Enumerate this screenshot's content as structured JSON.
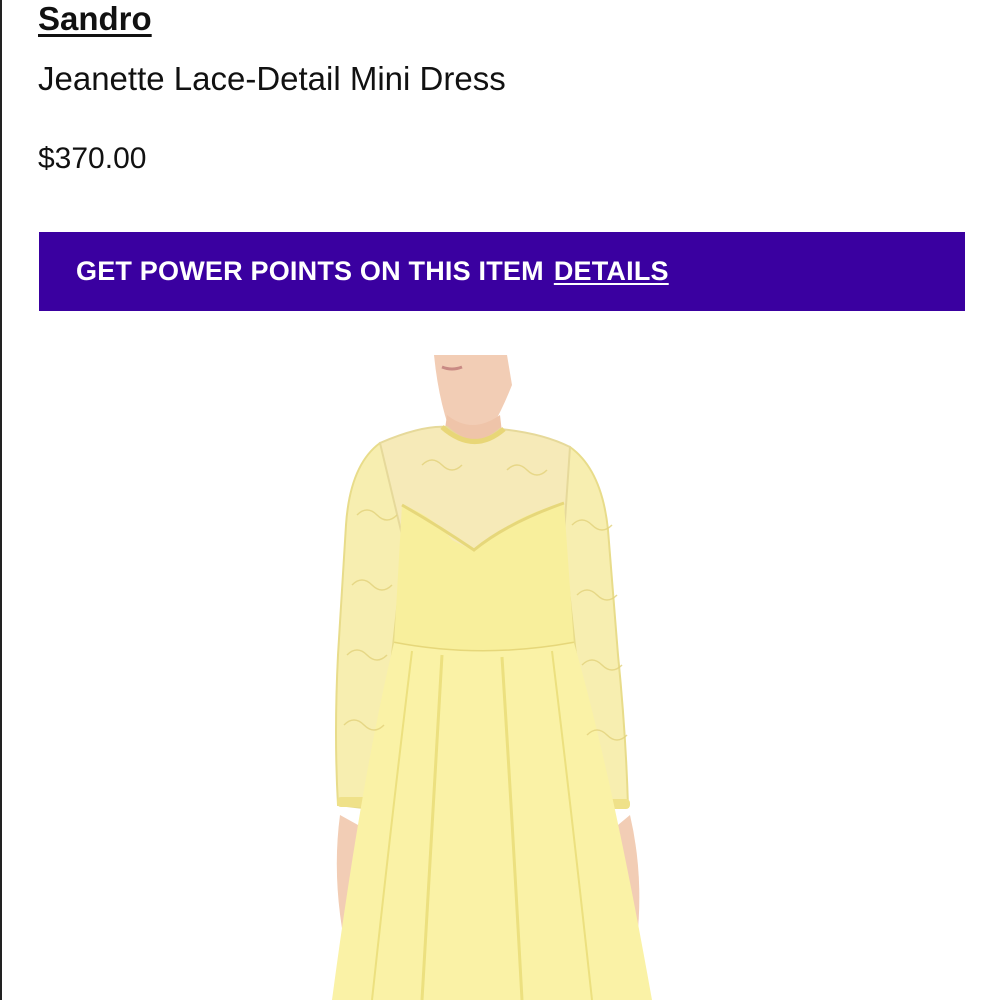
{
  "product": {
    "brand": "Sandro",
    "name": "Jeanette Lace-Detail Mini Dress",
    "price": "$370.00"
  },
  "banner": {
    "text": "GET POWER POINTS ON THIS ITEM",
    "link_label": "DETAILS",
    "background_color": "#3a00a0",
    "text_color": "#ffffff"
  },
  "image": {
    "subject": "yellow lace mini dress on model",
    "dress_color": "#f8ef9c"
  }
}
